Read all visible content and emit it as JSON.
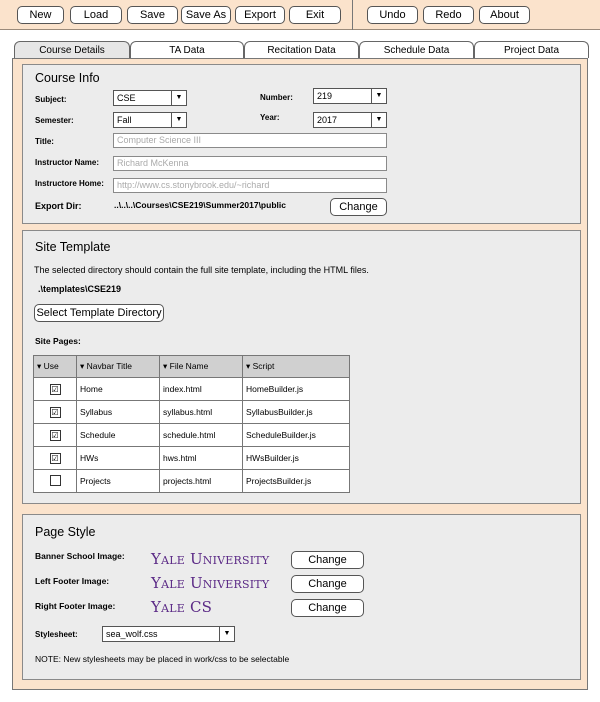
{
  "toolbar": {
    "new": "New",
    "load": "Load",
    "save": "Save",
    "save_as": "Save As",
    "export": "Export",
    "exit": "Exit",
    "undo": "Undo",
    "redo": "Redo",
    "about": "About"
  },
  "tabs": [
    "Course Details",
    "TA Data",
    "Recitation Data",
    "Schedule Data",
    "Project Data"
  ],
  "course_info": {
    "title": "Course Info",
    "subject_label": "Subject:",
    "subject_value": "CSE",
    "number_label": "Number:",
    "number_value": "219",
    "semester_label": "Semester:",
    "semester_value": "Fall",
    "year_label": "Year:",
    "year_value": "2017",
    "title_label": "Title:",
    "title_value": "Computer Science III",
    "instructor_name_label": "Instructor Name:",
    "instructor_name_value": "Richard McKenna",
    "instructor_home_label": "Instructore Home:",
    "instructor_home_value": "http://www.cs.stonybrook.edu/~richard",
    "export_dir_label": "Export Dir:",
    "export_dir_value": "..\\..\\..\\Courses\\CSE219\\Summer2017\\public",
    "change_button": "Change"
  },
  "site_template": {
    "title": "Site Template",
    "description": "The selected directory should contain the full site template, including the HTML files.",
    "path": ".\\templates\\CSE219",
    "select_button": "Select Template Directory",
    "site_pages_label": "Site Pages:",
    "columns": [
      "▾ Use",
      "▾ Navbar Title",
      "▾ File Name",
      "▾ Script"
    ],
    "rows": [
      {
        "use": "☑",
        "title": "Home",
        "file": "index.html",
        "script": "HomeBuilder.js"
      },
      {
        "use": "☑",
        "title": "Syllabus",
        "file": "syllabus.html",
        "script": "SyllabusBuilder.js"
      },
      {
        "use": "☑",
        "title": "Schedule",
        "file": "schedule.html",
        "script": "ScheduleBuilder.js"
      },
      {
        "use": "☑",
        "title": "HWs",
        "file": "hws.html",
        "script": "HWsBuilder.js"
      },
      {
        "use": "",
        "title": "Projects",
        "file": "projects.html",
        "script": "ProjectsBuilder.js"
      }
    ]
  },
  "page_style": {
    "title": "Page Style",
    "banner_label": "Banner School Image:",
    "left_footer_label": "Left Footer Image:",
    "right_footer_label": "Right Footer Image:",
    "banner_logo": "Yale University",
    "left_logo": "Yale University",
    "right_logo": "Yale CS",
    "change_button": "Change",
    "stylesheet_label": "Stylesheet:",
    "stylesheet_value": "sea_wolf.css",
    "note": "NOTE: New stylesheets may be placed in work/css to be selectable"
  },
  "icons": {
    "dropdown": "chevron-down-icon",
    "checkbox": "checkbox-icon"
  },
  "colors": {
    "background": "#fbe3cc",
    "panel": "#ececec",
    "logo": "#5b2a86"
  }
}
